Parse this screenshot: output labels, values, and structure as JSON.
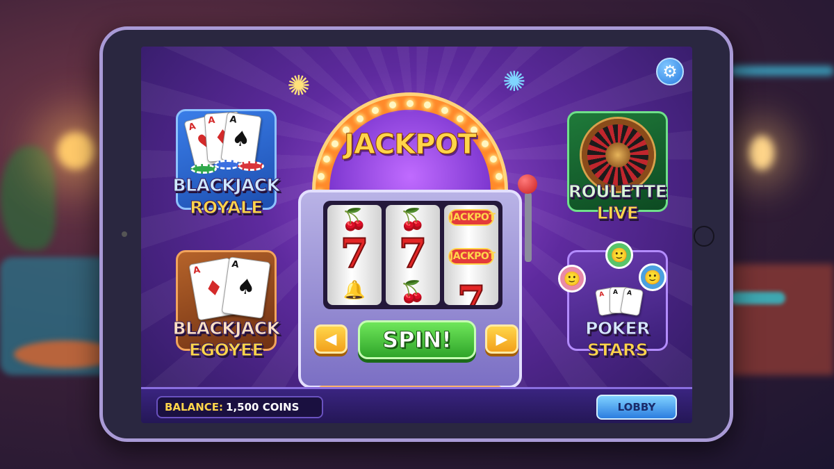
{
  "settings": {
    "icon": "gear-icon"
  },
  "slot": {
    "title": "JACKPOT",
    "spin_label": "SPIN!",
    "left_arrow": "◀",
    "right_arrow": "▶",
    "reels": [
      [
        "cherry",
        "seven",
        "bell"
      ],
      [
        "cherry",
        "seven",
        "cherry"
      ],
      [
        "JACKPOT",
        "JACKPOT",
        "seven"
      ]
    ],
    "jackpot_symbol": "JACKPOT"
  },
  "games": [
    {
      "line1": "BLACKJACK",
      "line2": "ROYALE"
    },
    {
      "line1": "BLACKJACK",
      "line2": "EGOYEE"
    },
    {
      "line1": "ROULETTE",
      "line2": "LIVE"
    },
    {
      "line1": "POKER",
      "line2": "STARS"
    }
  ],
  "footer": {
    "balance_label": "BALANCE:",
    "balance_value": "1,500 COINS",
    "lobby_label": "LOBBY"
  }
}
